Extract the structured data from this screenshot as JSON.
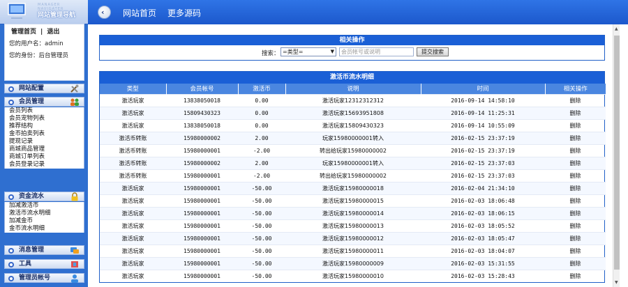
{
  "sidebar": {
    "logo_sub": "MANAGER NAVIGATER",
    "logo_title": "网站管理导航",
    "links": {
      "home": "管理首页",
      "sep": "|",
      "logout": "退出"
    },
    "user_label": "您的用户名：admin",
    "role_label": "您的身份：后台管理员",
    "groups": [
      {
        "title": "网站配置",
        "icon": "tools-icon",
        "items": []
      },
      {
        "title": "会员管理",
        "icon": "users-icon",
        "items": [
          "会员列表",
          "会员宠物列表",
          "推荐结构",
          "金币拍卖列表",
          "提现记录",
          "商城商品管理",
          "商城订单列表",
          "会员登录记录"
        ]
      },
      {
        "title": "资金流水",
        "icon": "lock-icon",
        "items": [
          "加减激活币",
          "激活币流水明细",
          "加减金币",
          "金币流水明细"
        ]
      },
      {
        "title": "消息管理",
        "icon": "message-icon",
        "items": []
      },
      {
        "title": "工具",
        "icon": "tool-icon",
        "items": []
      },
      {
        "title": "管理员帐号",
        "icon": "admin-icon",
        "items": []
      }
    ]
  },
  "topbar": {
    "back_icon": "back-arrow-icon",
    "home": "网站首页",
    "more": "更多源码"
  },
  "search_panel": {
    "title": "相关操作",
    "label": "搜索：",
    "select_value": "=类型=",
    "input_placeholder": "会员帐号或说明",
    "button": "提交搜索"
  },
  "list_panel": {
    "title": "激活币流水明细",
    "columns": [
      "类型",
      "会员帐号",
      "激活币",
      "说明",
      "时间",
      "相关操作"
    ],
    "rows": [
      [
        "激活玩家",
        "13838050018",
        "0.00",
        "激活玩家12312312312",
        "2016-09-14 14:58:10",
        "删除"
      ],
      [
        "激活玩家",
        "15809430323",
        "0.00",
        "激活玩家15693951808",
        "2016-09-14 11:25:31",
        "删除"
      ],
      [
        "激活玩家",
        "13838050018",
        "0.00",
        "激活玩家15809430323",
        "2016-09-14 10:55:09",
        "删除"
      ],
      [
        "激活币转账",
        "15980000002",
        "2.00",
        "玩家15980000001转入",
        "2016-02-15 23:37:19",
        "删除"
      ],
      [
        "激活币转账",
        "15980000001",
        "-2.00",
        "转出给玩家15980000002",
        "2016-02-15 23:37:19",
        "删除"
      ],
      [
        "激活币转账",
        "15980000002",
        "2.00",
        "玩家15980000001转入",
        "2016-02-15 23:37:03",
        "删除"
      ],
      [
        "激活币转账",
        "15980000001",
        "-2.00",
        "转出给玩家15980000002",
        "2016-02-15 23:37:03",
        "删除"
      ],
      [
        "激活玩家",
        "15980000001",
        "-50.00",
        "激活玩家15980000018",
        "2016-02-04 21:34:10",
        "删除"
      ],
      [
        "激活玩家",
        "15980000001",
        "-50.00",
        "激活玩家15980000015",
        "2016-02-03 18:06:48",
        "删除"
      ],
      [
        "激活玩家",
        "15980000001",
        "-50.00",
        "激活玩家15980000014",
        "2016-02-03 18:06:15",
        "删除"
      ],
      [
        "激活玩家",
        "15980000001",
        "-50.00",
        "激活玩家15980000013",
        "2016-02-03 18:05:52",
        "删除"
      ],
      [
        "激活玩家",
        "15980000001",
        "-50.00",
        "激活玩家15980000012",
        "2016-02-03 18:05:47",
        "删除"
      ],
      [
        "激活玩家",
        "15980000001",
        "-50.00",
        "激活玩家15980000011",
        "2016-02-03 18:04:07",
        "删除"
      ],
      [
        "激活玩家",
        "15980000001",
        "-50.00",
        "激活玩家15980000009",
        "2016-02-03 15:31:55",
        "删除"
      ],
      [
        "激活玩家",
        "15980000001",
        "-50.00",
        "激活玩家15980000010",
        "2016-02-03 15:28:43",
        "删除"
      ]
    ]
  }
}
